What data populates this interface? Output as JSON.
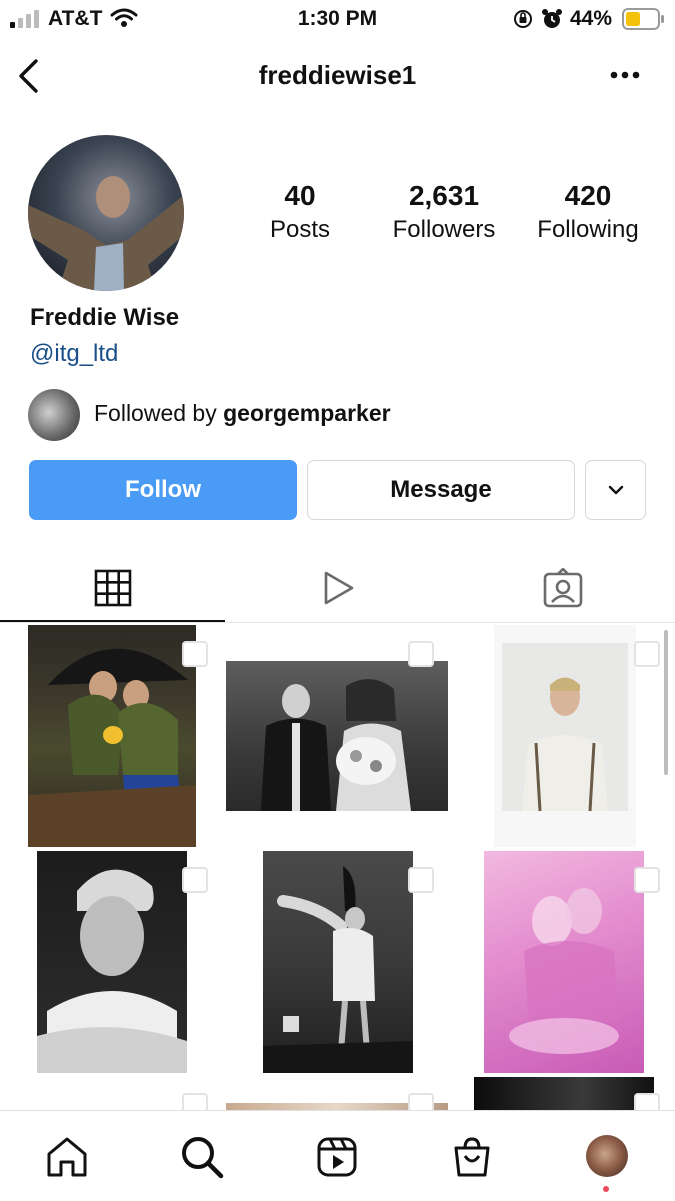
{
  "status_bar": {
    "carrier": "AT&T",
    "time": "1:30 PM",
    "battery_percent": "44%"
  },
  "header": {
    "username": "freddiewise1",
    "back_icon": "chevron-left-icon",
    "more_icon": "ellipsis-icon"
  },
  "profile": {
    "full_name": "Freddie Wise",
    "handle": "@itg_ltd",
    "stats": [
      {
        "value": "40",
        "label": "Posts"
      },
      {
        "value": "2,631",
        "label": "Followers"
      },
      {
        "value": "420",
        "label": "Following"
      }
    ],
    "followed_by_prefix": "Followed by",
    "followed_by_user": "georgemparker"
  },
  "actions": {
    "follow_label": "Follow",
    "message_label": "Message",
    "accent_color": "#4a9bf5"
  },
  "tabs": [
    "grid-icon",
    "reels-icon",
    "tagged-icon"
  ],
  "grid": [
    {
      "description_icon": "photo-couple-under-umbrella",
      "multi_icon": "carousel-icon"
    },
    {
      "description_icon": "photo-wedding-couple",
      "multi_icon": "carousel-icon"
    },
    {
      "description_icon": "photo-polaroid-portrait",
      "multi_icon": "carousel-icon"
    },
    {
      "description_icon": "photo-bw-portrait",
      "multi_icon": "carousel-icon"
    },
    {
      "description_icon": "photo-dancing-woman",
      "multi_icon": "carousel-icon"
    },
    {
      "description_icon": "photo-pink-painting",
      "multi_icon": "carousel-icon"
    }
  ],
  "bottom_nav": [
    "home-icon",
    "search-icon",
    "reels-icon",
    "shop-icon",
    "profile-avatar"
  ]
}
